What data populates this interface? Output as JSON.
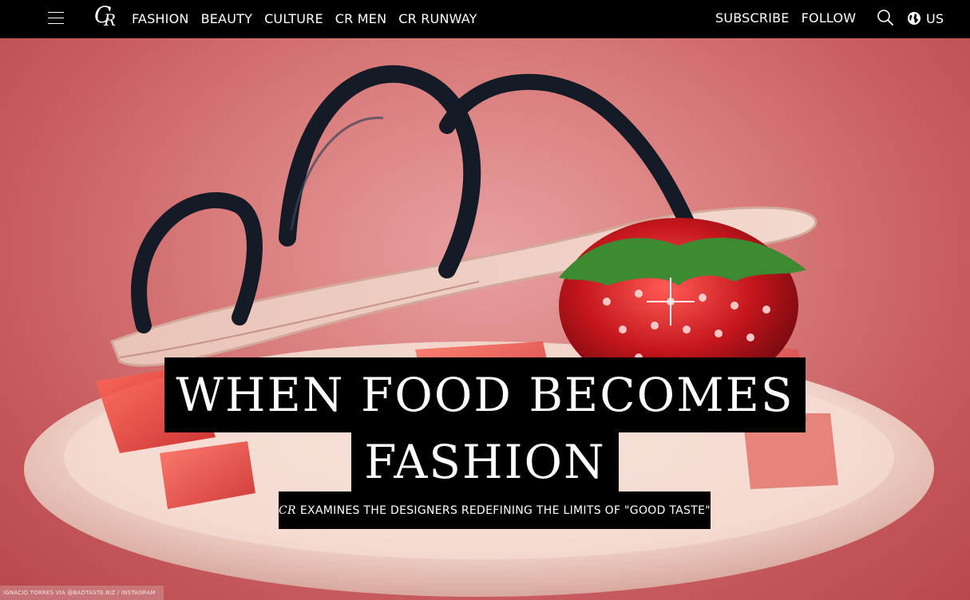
{
  "header": {
    "logo": {
      "c": "C",
      "r": "R"
    },
    "nav": [
      {
        "label": "FASHION"
      },
      {
        "label": "BEAUTY"
      },
      {
        "label": "CULTURE"
      },
      {
        "label": "CR MEN"
      },
      {
        "label": "CR RUNWAY"
      }
    ],
    "subscribe_label": "SUBSCRIBE",
    "follow_label": "FOLLOW",
    "region_label": "US",
    "icons": {
      "menu": "hamburger-icon",
      "search": "search-icon",
      "region": "globe-icon"
    }
  },
  "hero": {
    "headline_line1": "WHEN FOOD BECOMES",
    "headline_line2": "FASHION",
    "subhead_em": "CR",
    "subhead_rest": "EXAMINES THE DESIGNERS REDEFINING THE LIMITS OF \"GOOD TASTE\"",
    "photo_credit": "IGNACIO TORRES VIA @BADTASTE.BIZ / INSTAGRAM",
    "image_subject": "black strappy sandal on a plate with a jeweled strawberry heel and red jelly cubes",
    "colors": {
      "background": "#d97c7c",
      "strap": "#141a26",
      "strawberry": "#c4161c",
      "jelly": "#e0322c"
    }
  }
}
